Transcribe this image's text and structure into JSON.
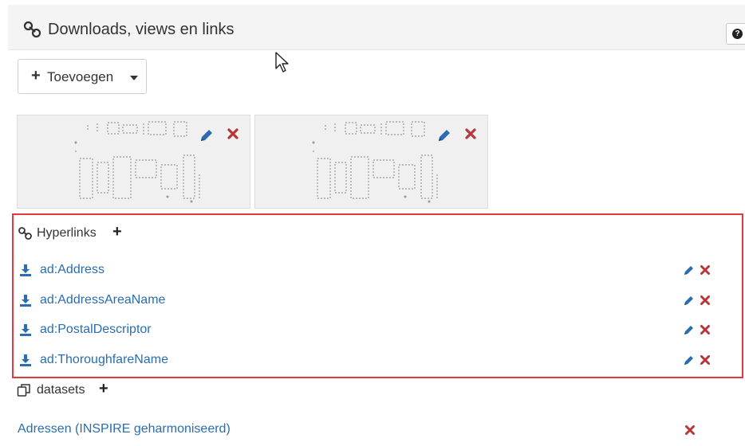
{
  "panel": {
    "title": "Downloads, views en links",
    "help_label": "?",
    "title_icon": "link-icon"
  },
  "add_menu": {
    "plus": "+",
    "label": "Toevoegen"
  },
  "thumbnails": [
    {
      "edit_icon": "pencil-icon",
      "delete_icon": "remove-icon"
    },
    {
      "edit_icon": "pencil-icon",
      "delete_icon": "remove-icon"
    }
  ],
  "hyperlinks": {
    "title": "Hyperlinks",
    "add": "+",
    "items": [
      {
        "label": "ad:Address"
      },
      {
        "label": "ad:AddressAreaName"
      },
      {
        "label": "ad:PostalDescriptor"
      },
      {
        "label": "ad:ThoroughfareName"
      }
    ]
  },
  "datasets": {
    "title": "datasets",
    "add": "+",
    "items": [
      {
        "label": "Adressen (INSPIRE geharmoniseerd)"
      }
    ]
  },
  "colors": {
    "link": "#2a6db0",
    "delete": "#b5373a",
    "highlight_border": "#e0393e",
    "header_bg": "#f4f4f4"
  }
}
